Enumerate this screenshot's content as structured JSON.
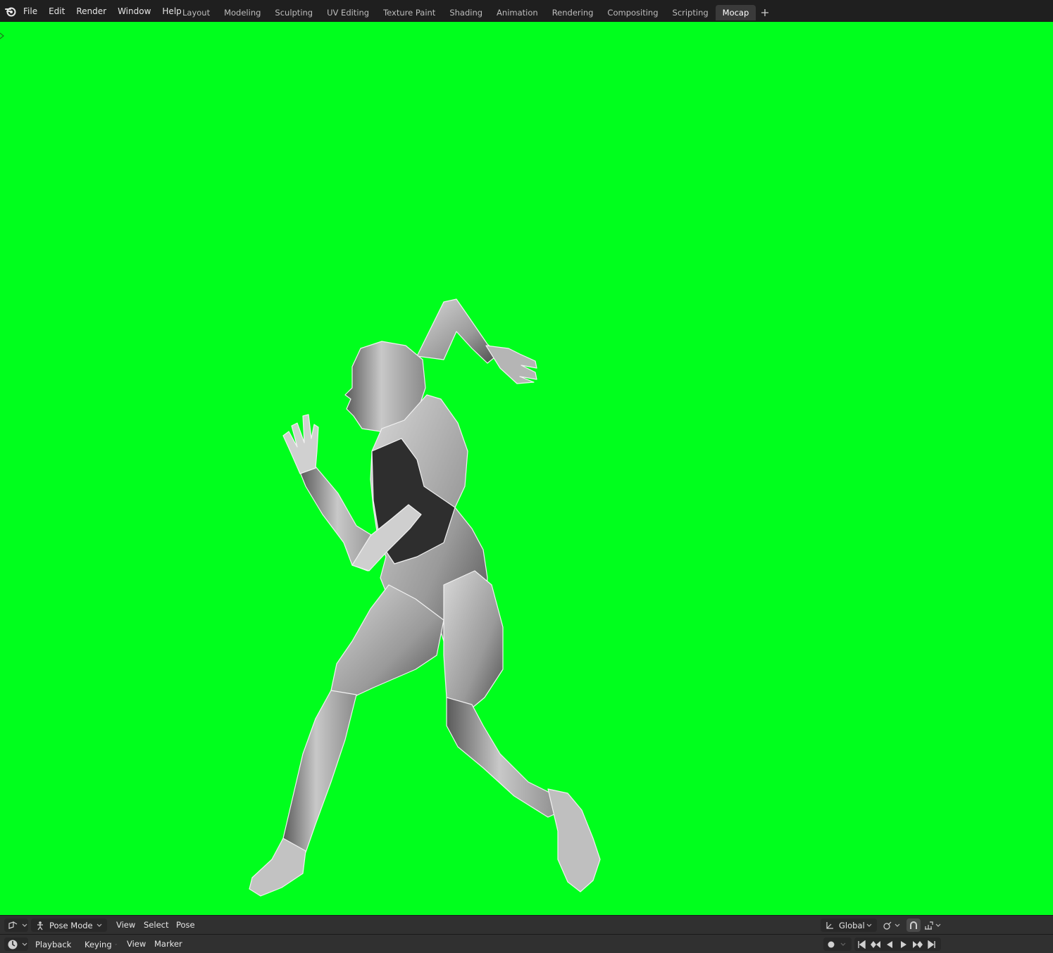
{
  "topbar": {
    "logo_icon": "blender-logo-icon",
    "menus": [
      "File",
      "Edit",
      "Render",
      "Window",
      "Help"
    ],
    "workspaces": [
      "Layout",
      "Modeling",
      "Sculpting",
      "UV Editing",
      "Texture Paint",
      "Shading",
      "Animation",
      "Rendering",
      "Compositing",
      "Scripting",
      "Mocap"
    ],
    "active_workspace": "Mocap",
    "add_workspace_icon": "plus-icon"
  },
  "viewport": {
    "background_color": "#00ff1d",
    "subject": "posed-3d-human-mesh-running"
  },
  "viewport_header": {
    "editor_type_icon": "3d-viewport-icon",
    "mode": "Pose Mode",
    "menus": [
      "View",
      "Select",
      "Pose"
    ],
    "transform_orientation": "Global",
    "pivot_icon": "pivot-icon",
    "snap_icon": "magnet-icon",
    "proportional_icon": "snap-increment-icon"
  },
  "timeline_header": {
    "editor_type_icon": "timeline-clock-icon",
    "menus": [
      "Playback",
      "Keying",
      "View",
      "Marker"
    ],
    "record_icon": "record-icon",
    "playback_controls": [
      "jump-start-icon",
      "prev-keyframe-icon",
      "play-reverse-icon",
      "play-icon",
      "next-keyframe-icon",
      "jump-end-icon"
    ]
  }
}
